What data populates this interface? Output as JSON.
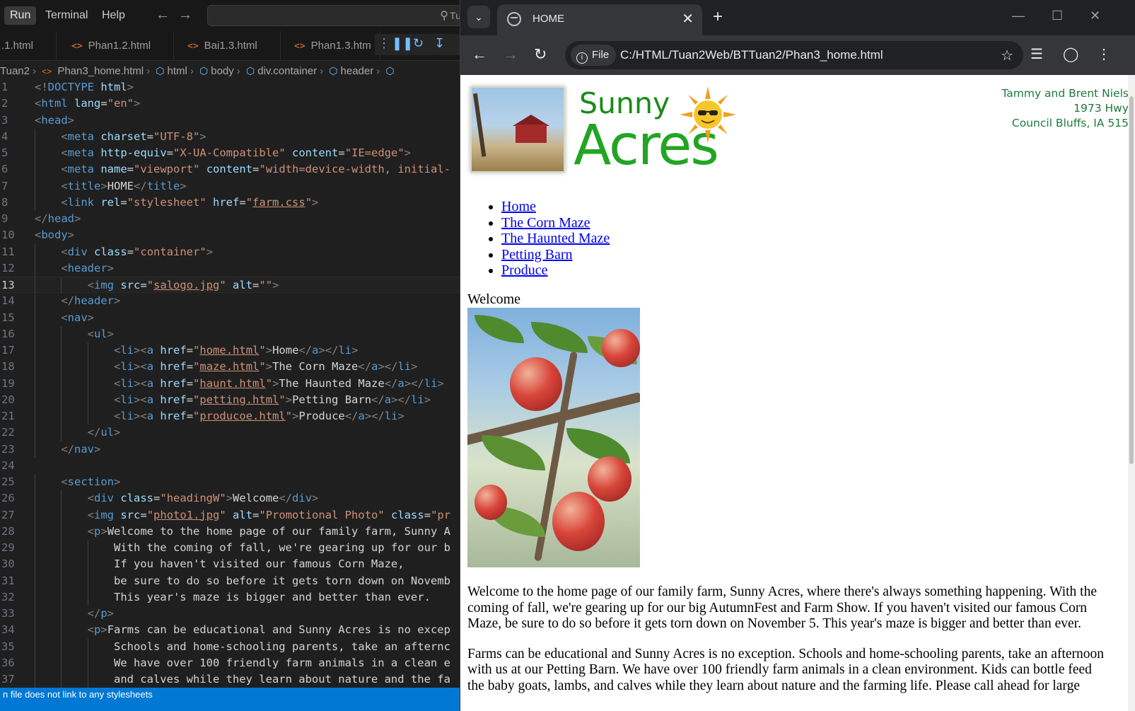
{
  "vscode": {
    "menu": {
      "run": "Run",
      "terminal": "Terminal",
      "help": "Help"
    },
    "command_center_text": "Tu",
    "tabs": [
      {
        "label": ".1.html"
      },
      {
        "label": "Phan1.2.html"
      },
      {
        "label": "Bai1.3.html"
      },
      {
        "label": "Phan1.3.htm"
      }
    ],
    "breadcrumb": [
      "Tuan2",
      "Phan3_home.html",
      "html",
      "body",
      "div.container",
      "header"
    ],
    "active_line": 13,
    "code_lines": [
      {
        "n": "1",
        "t": "<!DOCTYPE html>"
      },
      {
        "n": "2",
        "t": "<html lang=\"en\">"
      },
      {
        "n": "3",
        "t": "<head>"
      },
      {
        "n": "4",
        "t": "    <meta charset=\"UTF-8\">"
      },
      {
        "n": "5",
        "t": "    <meta http-equiv=\"X-UA-Compatible\" content=\"IE=edge\">"
      },
      {
        "n": "6",
        "t": "    <meta name=\"viewport\" content=\"width=device-width, initial-"
      },
      {
        "n": "7",
        "t": "    <title>HOME</title>"
      },
      {
        "n": "8",
        "t": "    <link rel=\"stylesheet\" href=\"farm.css\">"
      },
      {
        "n": "9",
        "t": "</head>"
      },
      {
        "n": "10",
        "t": "<body>"
      },
      {
        "n": "11",
        "t": "    <div class=\"container\">"
      },
      {
        "n": "12",
        "t": "    <header>"
      },
      {
        "n": "13",
        "t": "        <img src=\"salogo.jpg\" alt=\"\">"
      },
      {
        "n": "14",
        "t": "    </header>"
      },
      {
        "n": "15",
        "t": "    <nav>"
      },
      {
        "n": "16",
        "t": "        <ul>"
      },
      {
        "n": "17",
        "t": "            <li><a href=\"home.html\">Home</a></li>"
      },
      {
        "n": "18",
        "t": "            <li><a href=\"maze.html\">The Corn Maze</a></li>"
      },
      {
        "n": "19",
        "t": "            <li><a href=\"haunt.html\">The Haunted Maze</a></li>"
      },
      {
        "n": "20",
        "t": "            <li><a href=\"petting.html\">Petting Barn</a></li>"
      },
      {
        "n": "21",
        "t": "            <li><a href=\"producoe.html\">Produce</a></li>"
      },
      {
        "n": "22",
        "t": "        </ul>"
      },
      {
        "n": "23",
        "t": "    </nav>"
      },
      {
        "n": "24",
        "t": ""
      },
      {
        "n": "25",
        "t": "    <section>"
      },
      {
        "n": "26",
        "t": "        <div class=\"headingW\">Welcome</div>"
      },
      {
        "n": "27",
        "t": "        <img src=\"photo1.jpg\" alt=\"Promotional Photo\" class=\"pr"
      },
      {
        "n": "28",
        "t": "        <p>Welcome to the home page of our family farm, Sunny A"
      },
      {
        "n": "29",
        "t": "            With the coming of fall, we're gearing up for our b"
      },
      {
        "n": "30",
        "t": "            If you haven't visited our famous Corn Maze,"
      },
      {
        "n": "31",
        "t": "            be sure to do so before it gets torn down on Novemb"
      },
      {
        "n": "32",
        "t": "            This year's maze is bigger and better than ever."
      },
      {
        "n": "33",
        "t": "        </p>"
      },
      {
        "n": "34",
        "t": "        <p>Farms can be educational and Sunny Acres is no excep"
      },
      {
        "n": "35",
        "t": "            Schools and home-schooling parents, take an afternc"
      },
      {
        "n": "36",
        "t": "            We have over 100 friendly farm animals in a clean e"
      },
      {
        "n": "37",
        "t": "            and calves while they learn about nature and the fa"
      }
    ],
    "status_text": "n file does not link to any stylesheets"
  },
  "browser": {
    "tab_title": "HOME",
    "chip_label": "File",
    "url": "C:/HTML/Tuan2Web/BTTuan2/Phan3_home.html",
    "page": {
      "logo": {
        "sunny": "Sunny",
        "acres": "Acres"
      },
      "address": [
        "Tammy and Brent Niels",
        "1973 Hwy",
        "Council Bluffs, IA  515"
      ],
      "nav": [
        "Home",
        "The Corn Maze",
        "The Haunted Maze",
        "Petting Barn",
        "Produce"
      ],
      "heading": "Welcome",
      "paragraphs": [
        "Welcome to the home page of our family farm, Sunny Acres, where there's always something happening. With the coming of fall, we're gearing up for our big AutumnFest and Farm Show. If you haven't visited our famous Corn Maze, be sure to do so before it gets torn down on November 5. This year's maze is bigger and better than ever.",
        "Farms can be educational and Sunny Acres is no exception. Schools and home-schooling parents, take an afternoon with us at our Petting Barn. We have over 100 friendly farm animals in a clean environment. Kids can bottle feed the baby goats, lambs, and calves while they learn about nature and the farming life. Please call ahead for large"
      ]
    }
  },
  "colors": {
    "vscode_bg": "#1f1f1f",
    "status_bar": "#0078d4",
    "chrome_toolbar": "#35363a",
    "logo_green": "#22a522",
    "link": "#0000ee"
  }
}
